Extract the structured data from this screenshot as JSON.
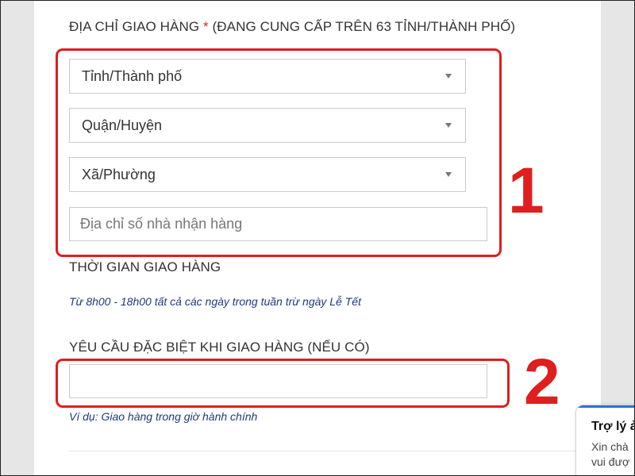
{
  "address_section": {
    "label": "ĐỊA CHỈ GIAO HÀNG",
    "required_marker": "*",
    "note": "(ĐANG CUNG CẤP TRÊN 63 TỈNH/THÀNH PHỐ)",
    "province_select": "Tỉnh/Thành phố",
    "district_select": "Quận/Huyện",
    "ward_select": "Xã/Phường",
    "street_placeholder": "Địa chỉ số nhà nhận hàng"
  },
  "delivery_time": {
    "label": "THỜI GIAN GIAO HÀNG",
    "hint": "Từ 8h00 - 18h00 tất cả các ngày trong tuần trừ ngày Lễ Tết"
  },
  "special_request": {
    "label": "YÊU CẦU ĐẶC BIỆT KHI GIAO HÀNG (NẾU CÓ)",
    "value": "",
    "hint": "Ví dụ: Giao hàng trong giờ hành chính"
  },
  "annotations": {
    "step_1": "1",
    "step_2": "2",
    "highlight_color": "#e01e1e"
  },
  "chat_widget": {
    "title": "Trợ lý ả",
    "line_1": "Xin chà",
    "line_2": "vui đượ",
    "accent_color": "#2f6fd8"
  },
  "colors": {
    "hint_text": "#1e3a78",
    "required_marker": "#e02020",
    "gutter": "#e6e6e6"
  }
}
